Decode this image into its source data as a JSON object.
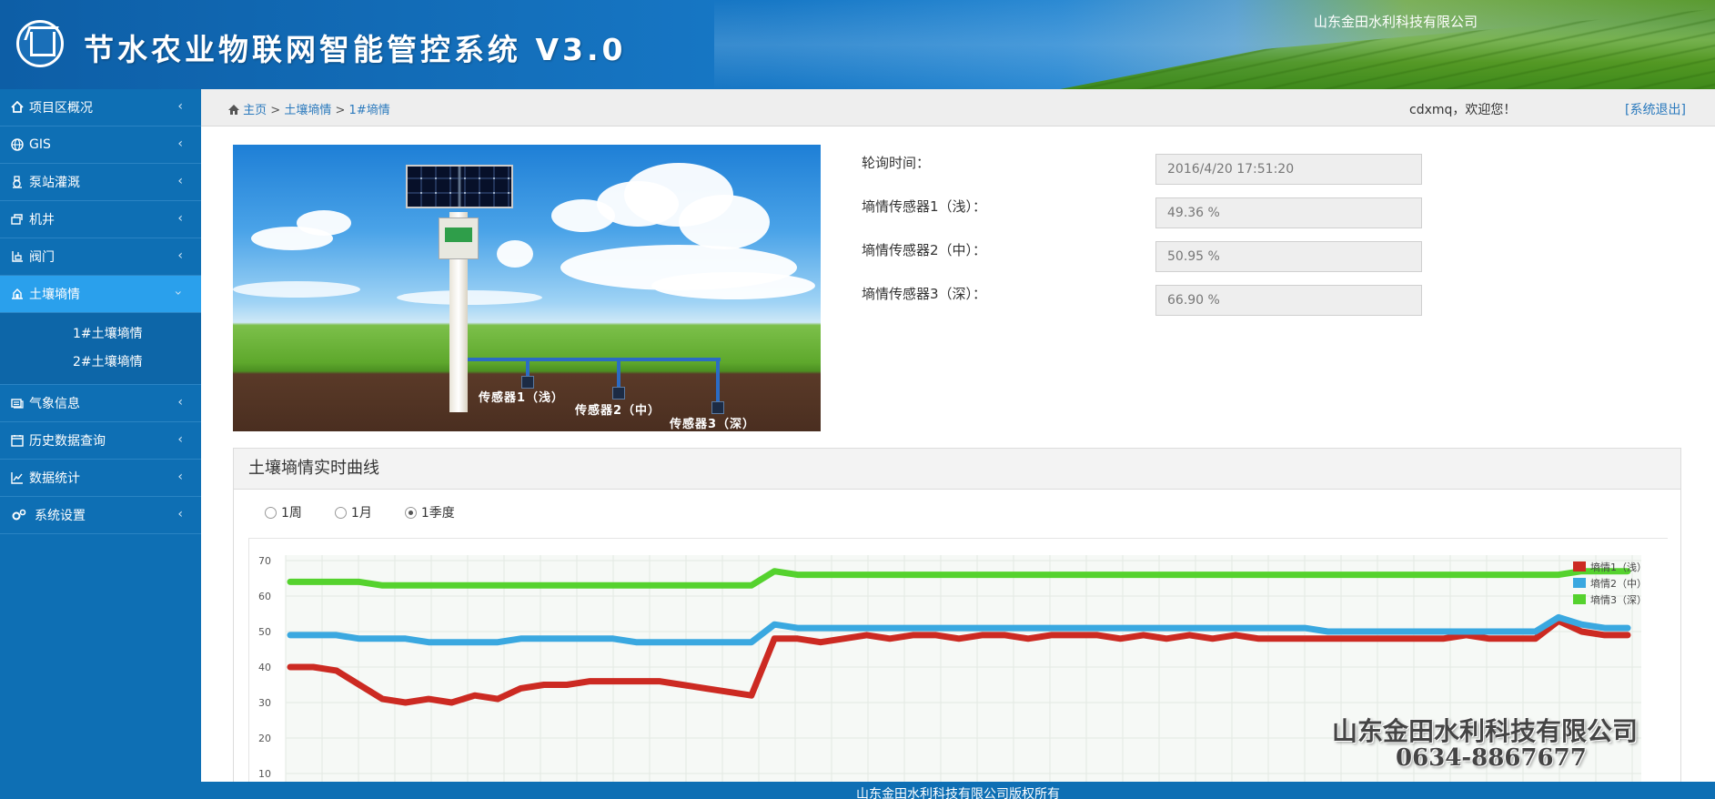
{
  "header": {
    "title": "节水农业物联网智能管控系统 V3.0",
    "company": "山东金田水利科技有限公司"
  },
  "sidebar": {
    "items": [
      {
        "label": "项目区概况",
        "icon": "home-icon"
      },
      {
        "label": "GIS",
        "icon": "globe-icon"
      },
      {
        "label": "泵站灌溉",
        "icon": "pump-icon"
      },
      {
        "label": "机井",
        "icon": "well-icon"
      },
      {
        "label": "阀门",
        "icon": "valve-icon"
      },
      {
        "label": "土壤墒情",
        "icon": "soil-icon"
      },
      {
        "label": "气象信息",
        "icon": "weather-icon"
      },
      {
        "label": "历史数据查询",
        "icon": "calendar-icon"
      },
      {
        "label": "数据统计",
        "icon": "chart-icon"
      },
      {
        "label": "系统设置",
        "icon": "gears-icon"
      }
    ],
    "sub_items": [
      "1#土壤墒情",
      "2#土壤墒情"
    ]
  },
  "breadcrumb": {
    "home": "主页",
    "sep": ">",
    "level1": "土壤墒情",
    "level2": "1#墒情"
  },
  "user": {
    "welcome": "cdxmq，欢迎您！",
    "logout": "[系统退出]"
  },
  "photo": {
    "sensor1": "传感器1（浅）",
    "sensor2": "传感器2（中）",
    "sensor3": "传感器3（深）"
  },
  "readings": [
    {
      "label": "轮询时间：",
      "value": "2016/4/20 17:51:20"
    },
    {
      "label": "墒情传感器1（浅）：",
      "value": "49.36 %"
    },
    {
      "label": "墒情传感器2（中）：",
      "value": "50.95 %"
    },
    {
      "label": "墒情传感器3（深）：",
      "value": "66.90 %"
    }
  ],
  "chart_panel": {
    "title": "土壤墒情实时曲线",
    "ranges": [
      "1周",
      "1月",
      "1季度"
    ],
    "selected_range": "1季度"
  },
  "watermark": {
    "company": "山东金田水利科技有限公司",
    "phone": "0634-8867677"
  },
  "footer": {
    "text": "山东金田水利科技有限公司版权所有"
  },
  "chart_data": {
    "type": "line",
    "ylim": [
      10,
      70
    ],
    "yticks": [
      10,
      20,
      30,
      40,
      50,
      60,
      70
    ],
    "grid": true,
    "legend_position": "top-right",
    "series": [
      {
        "name": "墒情1（浅）",
        "color": "#cc2a22",
        "values": [
          40,
          40,
          39,
          35,
          31,
          30,
          31,
          30,
          32,
          31,
          34,
          35,
          35,
          36,
          36,
          36,
          36,
          35,
          34,
          33,
          32,
          48,
          48,
          47,
          48,
          49,
          48,
          49,
          49,
          48,
          49,
          49,
          48,
          49,
          49,
          49,
          48,
          49,
          48,
          49,
          48,
          49,
          48,
          48,
          48,
          48,
          48,
          48,
          48,
          48,
          48,
          49,
          48,
          48,
          48,
          53,
          50,
          49,
          49
        ]
      },
      {
        "name": "墒情2（中）",
        "color": "#3aa8e0",
        "values": [
          49,
          49,
          49,
          48,
          48,
          48,
          47,
          47,
          47,
          47,
          48,
          48,
          48,
          48,
          48,
          47,
          47,
          47,
          47,
          47,
          47,
          52,
          51,
          51,
          51,
          51,
          51,
          51,
          51,
          51,
          51,
          51,
          51,
          51,
          51,
          51,
          51,
          51,
          51,
          51,
          51,
          51,
          51,
          51,
          51,
          50,
          50,
          50,
          50,
          50,
          50,
          50,
          50,
          50,
          50,
          54,
          52,
          51,
          51
        ]
      },
      {
        "name": "墒情3（深）",
        "color": "#55d22e",
        "values": [
          64,
          64,
          64,
          64,
          63,
          63,
          63,
          63,
          63,
          63,
          63,
          63,
          63,
          63,
          63,
          63,
          63,
          63,
          63,
          63,
          63,
          67,
          66,
          66,
          66,
          66,
          66,
          66,
          66,
          66,
          66,
          66,
          66,
          66,
          66,
          66,
          66,
          66,
          66,
          66,
          66,
          66,
          66,
          66,
          66,
          66,
          66,
          66,
          66,
          66,
          66,
          66,
          66,
          66,
          66,
          66,
          67,
          67,
          67
        ]
      }
    ]
  }
}
